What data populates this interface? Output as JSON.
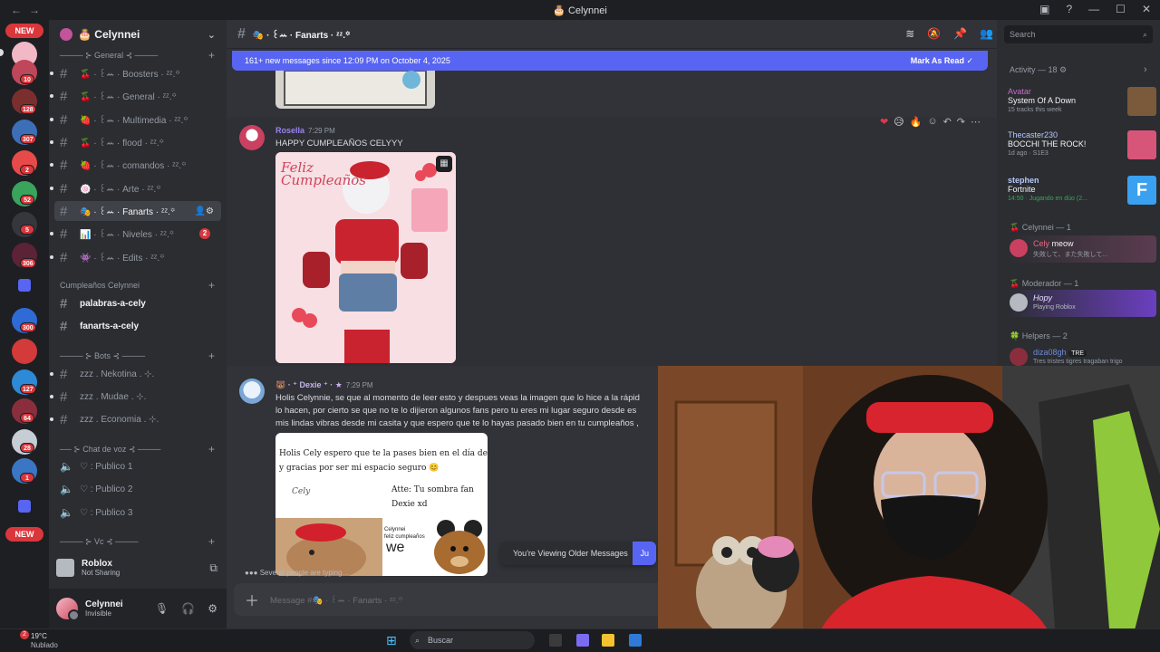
{
  "window": {
    "title": "🎂 Celynnei"
  },
  "servers": {
    "new_top": "NEW",
    "new_bottom": "NEW",
    "badges": [
      "10",
      "128",
      "307",
      "2",
      "52",
      "5",
      "306",
      "300",
      "127",
      "64",
      "28",
      "1"
    ]
  },
  "guild": {
    "name": "🎂 Celynnei",
    "categories": {
      "general": "──── ⊱ General ⊰ ────",
      "cumple": "Cumpleaños Celynnei",
      "bots": "──── ⊱ Bots ⊰ ────",
      "voz": "── ⊱ Chat de voz ⊰ ────",
      "vc": "──── ⊱ Vc ⊰ ────"
    },
    "channels": [
      "🍒 · ꒰ꕀ · Boosters · ᶻᶻ.꙳",
      "🍒 · ꒰ꕀ · General · ᶻᶻ.꙳",
      "🍓 · ꒰ꕀ · Multimedia · ᶻᶻ.꙳",
      "🍒 · ꒰ꕀ · flood · ᶻᶻ.꙳",
      "🍓 · ꒰ꕀ · comandos · ᶻᶻ.꙳",
      "🍥 · ꒰ꕀ · Arte · ᶻᶻ.꙳",
      "🎭 · ꒰ꕀ · Fanarts · ᶻᶻ.꙳",
      "📊 · ꒰ꕀ · Niveles · ᶻᶻ.꙳",
      "👾 · ꒰ꕀ · Edits · ᶻᶻ.꙳",
      "palabras-a-cely",
      "fanarts-a-cely",
      "zzz . Nekotina . ⊹.",
      "zzz . Mudae . ⊹.",
      "zzz . Economia . ⊹."
    ],
    "voice": [
      "♡ : Publico 1",
      "♡ : Publico 2",
      "♡ : Publico 3"
    ],
    "niveles_badge": "2"
  },
  "voicebar": {
    "name": "Roblox",
    "status": "Not Sharing"
  },
  "user": {
    "name": "Celynnei",
    "status": "Invisible"
  },
  "chat": {
    "channel": "🎭 · ꒰ꕀ · Fanarts · ᶻᶻ.꙳",
    "new_messages": "161+ new messages since 12:09 PM on October 4, 2025",
    "mark_read": "Mark As Read",
    "messages": [
      {
        "author": "Rosella",
        "time": "7:29 PM",
        "text": "HAPPY CUMPLEAÑOS CELYYY"
      },
      {
        "author": "🐻 · ⁺ Dexie ⁺ · ★",
        "time": "7:29 PM",
        "lines": [
          "Holis Celynnie, se que al momento de leer esto y despues veas la imagen que lo hice a la rápid",
          "lo hacen, por cierto se que no te lo dijieron algunos fans pero tu eres mi lugar seguro desde es",
          "mis lindas vibras desde mi casita y que espero que te lo hayas pasado bien en tu cumpleaños ,"
        ]
      }
    ],
    "art_caption": "Feliz Cumpleaños",
    "note": {
      "line1": "Holis Cely espero que te la pases bien en el día de hoy",
      "line2": "y gracias por ser mi espacio seguro 😊",
      "sign1": "Atte: Tu sombra fan",
      "sign2": "Dexie xd",
      "small1": "Celynnei",
      "small2": "feliz cumpleaños",
      "we": "we",
      "cely": "Cely"
    },
    "typing": "Several people are typing…",
    "older": "You're Viewing Older Messages",
    "jump": "Ju",
    "composer_placeholder": "Message #🎭 · ꒰ꕀ · Fanarts · ᶻᶻ.꙳"
  },
  "right": {
    "search_placeholder": "Search",
    "activity_header": "Activity — 18",
    "activities": [
      {
        "user": "Avatar",
        "title": "System Of A Down",
        "sub": "15 tracks this week"
      },
      {
        "user": "Thecaster230",
        "title": "BOCCHI THE ROCK!",
        "sub": "1d ago · S1E3"
      },
      {
        "user": "stephen",
        "title": "Fortnite",
        "sub": "14:50 · Jugando en dúo (2..."
      }
    ],
    "groups": [
      {
        "name": "Celynnei — 1",
        "member": "Cely",
        "member_status": "meow",
        "sub": "失敗して、また失敗して..."
      },
      {
        "name": "Moderador — 1",
        "member": "Hopy",
        "sub": "Playing Roblox"
      },
      {
        "name": "Helpers — 2",
        "member": "diza08gh",
        "tag": "TRE",
        "sub": "Tres tristes tigres tragaban trigo"
      }
    ]
  },
  "taskbar": {
    "temp": "19°C",
    "condition": "Nublado",
    "search": "Buscar",
    "weather_badge": "2"
  }
}
